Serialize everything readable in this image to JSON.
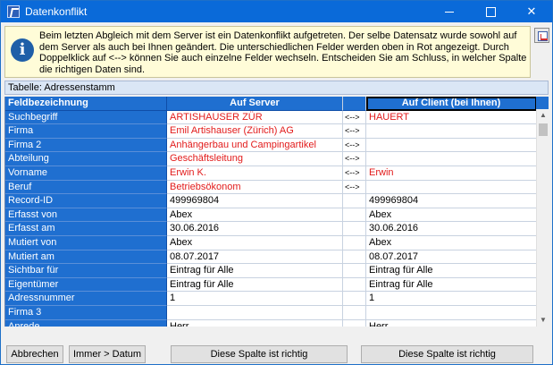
{
  "window": {
    "title": "Datenkonflikt"
  },
  "info": {
    "text": "Beim letzten Abgleich mit dem Server ist ein Datenkonflikt aufgetreten. Der selbe Datensatz wurde sowohl auf dem Server als auch bei Ihnen geändert. Die unterschiedlichen Felder werden oben in Rot angezeigt.  Durch Doppelklick auf <--> können Sie auch einzelne Felder wechseln. Entscheiden Sie am Schluss, in welcher Spalte die richtigen Daten sind."
  },
  "table_label": "Tabelle: Adressenstamm",
  "columns": {
    "field": "Feldbezeichnung",
    "server": "Auf Server",
    "client": "Auf Client (bei Ihnen)"
  },
  "swap_symbol": "<-->",
  "rows": [
    {
      "label": "Suchbegriff",
      "server": "ARTISHAUSER ZÜR",
      "client": "HAUERT",
      "diff": true,
      "swap": true
    },
    {
      "label": "Firma",
      "server": "Emil Artishauser (Zürich) AG",
      "client": "",
      "diff": true,
      "swap": true
    },
    {
      "label": "Firma 2",
      "server": "Anhängerbau und Campingartikel",
      "client": "",
      "diff": true,
      "swap": true
    },
    {
      "label": "Abteilung",
      "server": "Geschäftsleitung",
      "client": "",
      "diff": true,
      "swap": true
    },
    {
      "label": "Vorname",
      "server": "Erwin K.",
      "client": "Erwin",
      "diff": true,
      "swap": true
    },
    {
      "label": "Beruf",
      "server": "Betriebsökonom",
      "client": "",
      "diff": true,
      "swap": true
    },
    {
      "label": "Record-ID",
      "server": "499969804",
      "client": "499969804",
      "diff": false,
      "swap": false
    },
    {
      "label": "Erfasst von",
      "server": "Abex",
      "client": "Abex",
      "diff": false,
      "swap": false
    },
    {
      "label": "Erfasst am",
      "server": "30.06.2016",
      "client": "30.06.2016",
      "diff": false,
      "swap": false
    },
    {
      "label": "Mutiert von",
      "server": "Abex",
      "client": "Abex",
      "diff": false,
      "swap": false
    },
    {
      "label": "Mutiert am",
      "server": "08.07.2017",
      "client": "08.07.2017",
      "diff": false,
      "swap": false
    },
    {
      "label": "Sichtbar für",
      "server": "Eintrag für Alle",
      "client": "Eintrag für Alle",
      "diff": false,
      "swap": false
    },
    {
      "label": "Eigentümer",
      "server": "Eintrag für Alle",
      "client": "Eintrag für Alle",
      "diff": false,
      "swap": false
    },
    {
      "label": "Adressnummer",
      "server": "1",
      "client": "1",
      "diff": false,
      "swap": false
    },
    {
      "label": "Firma 3",
      "server": "",
      "client": "",
      "diff": false,
      "swap": false
    },
    {
      "label": "Anrede",
      "server": "Herr",
      "client": "Herr",
      "diff": false,
      "swap": false
    }
  ],
  "buttons": {
    "cancel": "Abbrechen",
    "always": "Immer >  Datum",
    "server_correct": "Diese Spalte ist richtig",
    "client_correct": "Diese Spalte ist richtig"
  },
  "icons": {
    "app": "app-logo-icon",
    "info": "info-icon",
    "tool": "compare-tool-icon"
  }
}
